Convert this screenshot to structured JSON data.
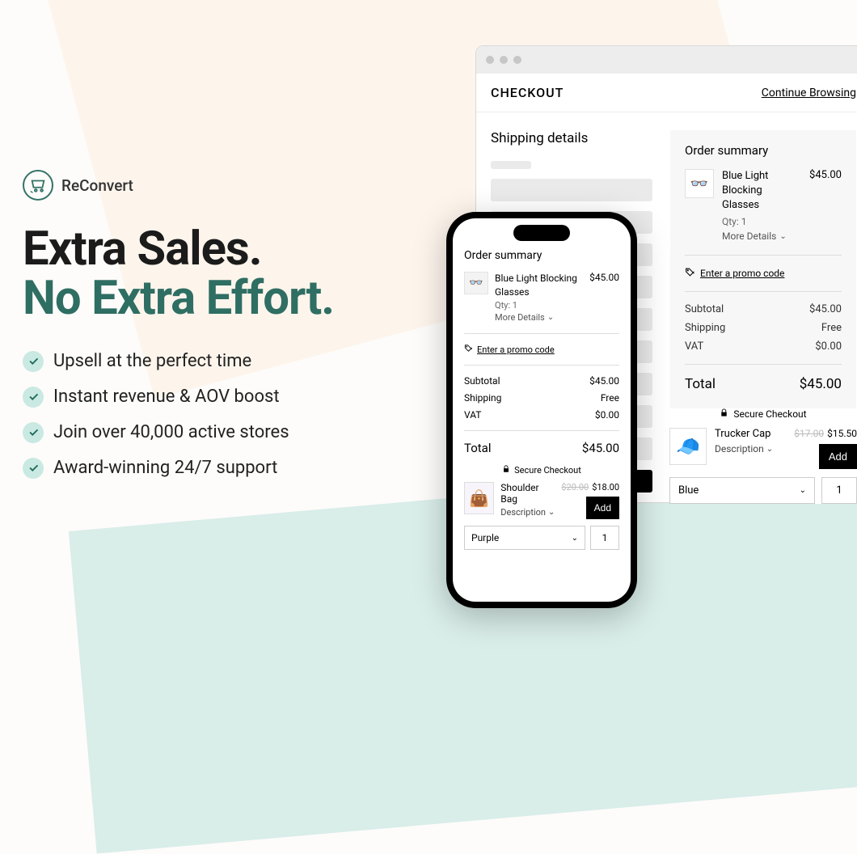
{
  "brand": {
    "name": "ReConvert"
  },
  "headline": {
    "line1": "Extra Sales.",
    "line2": "No Extra Effort."
  },
  "features": [
    "Upsell at the perfect time",
    "Instant revenue & AOV boost",
    "Join over 40,000 active stores",
    "Award-winning 24/7 support"
  ],
  "desktop": {
    "checkout_label": "CHECKOUT",
    "continue_label": "Continue Browsing",
    "shipping_title": "Shipping details",
    "order": {
      "title": "Order summary",
      "product": {
        "name": "Blue Light Blocking Glasses",
        "qty_label": "Qty: 1",
        "more_label": "More Details",
        "price": "$45.00"
      },
      "promo_label": "Enter a promo code",
      "subtotal_label": "Subtotal",
      "subtotal_value": "$45.00",
      "shipping_label": "Shipping",
      "shipping_value": "Free",
      "vat_label": "VAT",
      "vat_value": "$0.00",
      "total_label": "Total",
      "total_value": "$45.00"
    },
    "upsell": {
      "secure_label": "Secure Checkout",
      "name": "Trucker Cap",
      "old_price": "$17.00",
      "new_price": "$15.50",
      "desc_label": "Description",
      "add_label": "Add",
      "variant": "Blue",
      "qty": "1"
    }
  },
  "phone": {
    "order": {
      "title": "Order summary",
      "product": {
        "name": "Blue Light Blocking Glasses",
        "qty_label": "Qty: 1",
        "more_label": "More Details",
        "price": "$45.00"
      },
      "promo_label": "Enter a promo code",
      "subtotal_label": "Subtotal",
      "subtotal_value": "$45.00",
      "shipping_label": "Shipping",
      "shipping_value": "Free",
      "vat_label": "VAT",
      "vat_value": "$0.00",
      "total_label": "Total",
      "total_value": "$45.00"
    },
    "upsell": {
      "secure_label": "Secure Checkout",
      "name": "Shoulder Bag",
      "old_price": "$20.00",
      "new_price": "$18.00",
      "desc_label": "Description",
      "add_label": "Add",
      "variant": "Purple",
      "qty": "1"
    }
  }
}
